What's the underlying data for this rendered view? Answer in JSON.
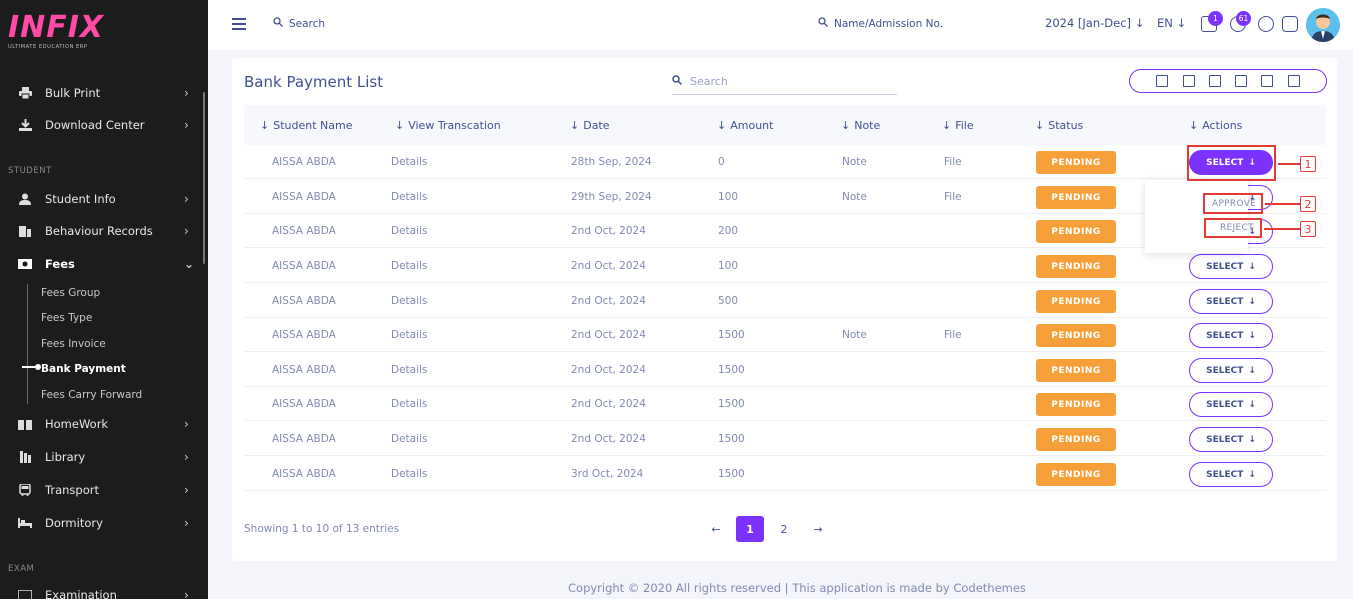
{
  "logo": {
    "main": "INFIX",
    "sub": "ULTIMATE EDUCATION ERP"
  },
  "sidebar": {
    "top_items": [
      {
        "label": "Bulk Print"
      },
      {
        "label": "Download Center"
      }
    ],
    "section_student": "STUDENT",
    "student_items": [
      {
        "label": "Student Info"
      },
      {
        "label": "Behaviour Records"
      },
      {
        "label": "Fees"
      }
    ],
    "fees_sub": [
      {
        "label": "Fees Group"
      },
      {
        "label": "Fees Type"
      },
      {
        "label": "Fees Invoice"
      },
      {
        "label": "Bank Payment"
      },
      {
        "label": "Fees Carry Forward"
      }
    ],
    "more_items": [
      {
        "label": "HomeWork"
      },
      {
        "label": "Library"
      },
      {
        "label": "Transport"
      },
      {
        "label": "Dormitory"
      }
    ],
    "section_exam": "EXAM",
    "exam_items": [
      {
        "label": "Examination"
      }
    ]
  },
  "topbar": {
    "search_label": "Search",
    "search2_label": "Name/Admission No.",
    "session": "2024 [Jan-Dec]",
    "lang": "EN",
    "chat_count": "1",
    "notif_count": "61"
  },
  "page": {
    "title": "Bank Payment List",
    "search_placeholder": "Search"
  },
  "table": {
    "headers": [
      "Student Name",
      "View Transcation",
      "Date",
      "Amount",
      "Note",
      "File",
      "Status",
      "Actions"
    ],
    "rows": [
      {
        "name": "AISSA ABDA",
        "details": "Details",
        "date": "28th Sep, 2024",
        "amount": "0",
        "note": "Note",
        "file": "File",
        "status": "PENDING",
        "action": "SELECT"
      },
      {
        "name": "AISSA ABDA",
        "details": "Details",
        "date": "29th Sep, 2024",
        "amount": "100",
        "note": "Note",
        "file": "File",
        "status": "PENDING",
        "action": "SELECT"
      },
      {
        "name": "AISSA ABDA",
        "details": "Details",
        "date": "2nd Oct, 2024",
        "amount": "200",
        "note": "",
        "file": "",
        "status": "PENDING",
        "action": "SELECT"
      },
      {
        "name": "AISSA ABDA",
        "details": "Details",
        "date": "2nd Oct, 2024",
        "amount": "100",
        "note": "",
        "file": "",
        "status": "PENDING",
        "action": "SELECT"
      },
      {
        "name": "AISSA ABDA",
        "details": "Details",
        "date": "2nd Oct, 2024",
        "amount": "500",
        "note": "",
        "file": "",
        "status": "PENDING",
        "action": "SELECT"
      },
      {
        "name": "AISSA ABDA",
        "details": "Details",
        "date": "2nd Oct, 2024",
        "amount": "1500",
        "note": "Note",
        "file": "File",
        "status": "PENDING",
        "action": "SELECT"
      },
      {
        "name": "AISSA ABDA",
        "details": "Details",
        "date": "2nd Oct, 2024",
        "amount": "1500",
        "note": "",
        "file": "",
        "status": "PENDING",
        "action": "SELECT"
      },
      {
        "name": "AISSA ABDA",
        "details": "Details",
        "date": "2nd Oct, 2024",
        "amount": "1500",
        "note": "",
        "file": "",
        "status": "PENDING",
        "action": "SELECT"
      },
      {
        "name": "AISSA ABDA",
        "details": "Details",
        "date": "2nd Oct, 2024",
        "amount": "1500",
        "note": "",
        "file": "",
        "status": "PENDING",
        "action": "SELECT"
      },
      {
        "name": "AISSA ABDA",
        "details": "Details",
        "date": "3rd Oct, 2024",
        "amount": "1500",
        "note": "",
        "file": "",
        "status": "PENDING",
        "action": "SELECT"
      }
    ]
  },
  "dropdown": {
    "approve": "APPROVE",
    "reject": "REJECT"
  },
  "callouts": [
    "1",
    "2",
    "3"
  ],
  "pagination": {
    "info": "Showing 1 to 10 of 13 entries",
    "pages": [
      "1",
      "2"
    ],
    "prev": "←",
    "next": "→"
  },
  "footer": "Copyright © 2020 All rights reserved | This application is made by Codethemes",
  "colors": {
    "accent": "#7c32ff",
    "pending": "#f7a03a",
    "text": "#415094",
    "callout": "#e53935"
  }
}
